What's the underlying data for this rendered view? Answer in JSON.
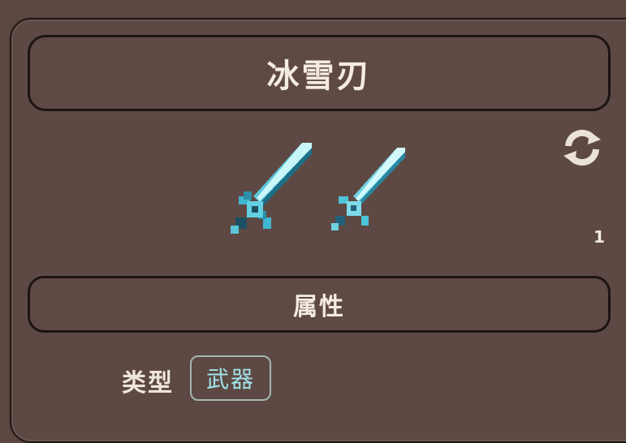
{
  "item": {
    "name": "冰雪刃",
    "count": "1"
  },
  "icons": {
    "refresh": "refresh-icon",
    "sword_primary": "sword-icon",
    "sword_secondary": "sword-icon"
  },
  "attributes": {
    "header": "属性",
    "type_label": "类型",
    "type_value": "武器"
  },
  "colors": {
    "blade_light": "#bff3f7",
    "blade_mid": "#59c6d8",
    "blade_dark": "#1d6f86",
    "hilt": "#3fb7d0"
  }
}
